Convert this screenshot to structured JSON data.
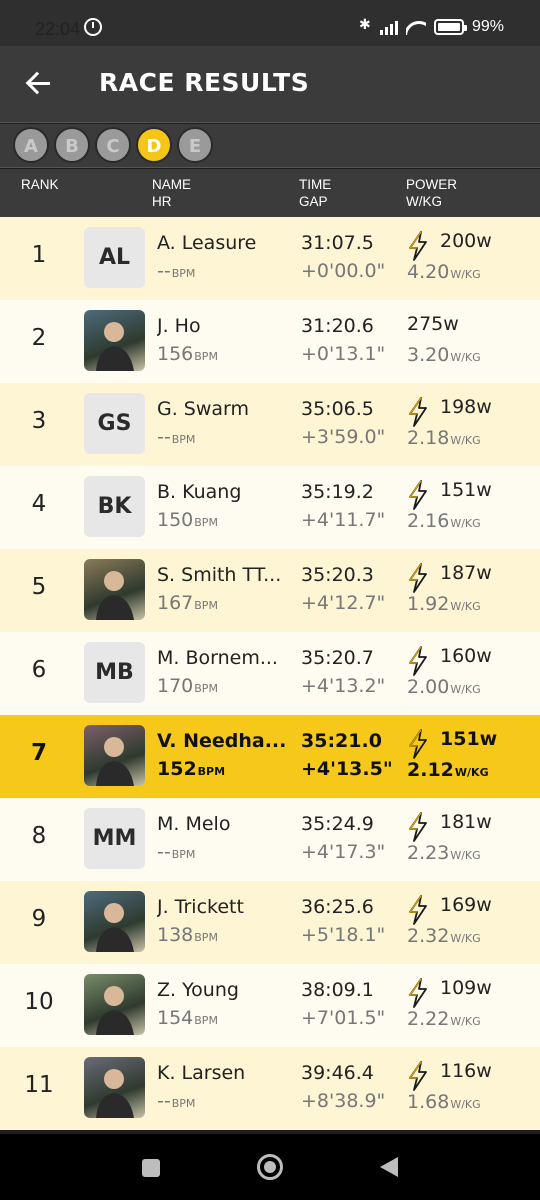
{
  "status": {
    "time": "22:04",
    "battery": "99%"
  },
  "header": {
    "title": "RACE RESULTS"
  },
  "categories": [
    "A",
    "B",
    "C",
    "D",
    "E"
  ],
  "active_category": "D",
  "columns": {
    "rank": "RANK",
    "name": "NAME",
    "hr": "HR",
    "time": "TIME",
    "gap": "GAP",
    "power": "POWER",
    "wkg": "W/KG"
  },
  "units": {
    "bpm": "BPM",
    "wkg": "W/KG"
  },
  "colors": {
    "accent": "#f6c81a",
    "row_odd": "#fdf5d4",
    "row_even": "#fefbf0"
  },
  "results": [
    {
      "rank": "1",
      "initials": "AL",
      "photo": false,
      "name": "A. Leasure",
      "hr": "--",
      "time": "31:07.5",
      "gap": "+0'00.0\"",
      "power": "200w",
      "wkg": "4.20",
      "bolt": true,
      "highlight": false
    },
    {
      "rank": "2",
      "initials": "",
      "photo": true,
      "name": "J. Ho",
      "hr": "156",
      "time": "31:20.6",
      "gap": "+0'13.1\"",
      "power": "275w",
      "wkg": "3.20",
      "bolt": false,
      "highlight": false
    },
    {
      "rank": "3",
      "initials": "GS",
      "photo": false,
      "name": "G. Swarm",
      "hr": "--",
      "time": "35:06.5",
      "gap": "+3'59.0\"",
      "power": "198w",
      "wkg": "2.18",
      "bolt": true,
      "highlight": false
    },
    {
      "rank": "4",
      "initials": "BK",
      "photo": false,
      "name": "B. Kuang",
      "hr": "150",
      "time": "35:19.2",
      "gap": "+4'11.7\"",
      "power": "151w",
      "wkg": "2.16",
      "bolt": true,
      "highlight": false
    },
    {
      "rank": "5",
      "initials": "",
      "photo": true,
      "name": "S. Smith TT...",
      "hr": "167",
      "time": "35:20.3",
      "gap": "+4'12.7\"",
      "power": "187w",
      "wkg": "1.92",
      "bolt": true,
      "highlight": false
    },
    {
      "rank": "6",
      "initials": "MB",
      "photo": false,
      "name": "M. Bornem...",
      "hr": "170",
      "time": "35:20.7",
      "gap": "+4'13.2\"",
      "power": "160w",
      "wkg": "2.00",
      "bolt": true,
      "highlight": false
    },
    {
      "rank": "7",
      "initials": "",
      "photo": true,
      "name": "V. Needha...",
      "hr": "152",
      "time": "35:21.0",
      "gap": "+4'13.5\"",
      "power": "151w",
      "wkg": "2.12",
      "bolt": true,
      "highlight": true
    },
    {
      "rank": "8",
      "initials": "MM",
      "photo": false,
      "name": "M. Melo",
      "hr": "--",
      "time": "35:24.9",
      "gap": "+4'17.3\"",
      "power": "181w",
      "wkg": "2.23",
      "bolt": true,
      "highlight": false
    },
    {
      "rank": "9",
      "initials": "",
      "photo": true,
      "name": "J. Trickett",
      "hr": "138",
      "time": "36:25.6",
      "gap": "+5'18.1\"",
      "power": "169w",
      "wkg": "2.32",
      "bolt": true,
      "highlight": false
    },
    {
      "rank": "10",
      "initials": "",
      "photo": true,
      "name": "Z. Young",
      "hr": "154",
      "time": "38:09.1",
      "gap": "+7'01.5\"",
      "power": "109w",
      "wkg": "2.22",
      "bolt": true,
      "highlight": false
    },
    {
      "rank": "11",
      "initials": "",
      "photo": true,
      "name": "K. Larsen",
      "hr": "--",
      "time": "39:46.4",
      "gap": "+8'38.9\"",
      "power": "116w",
      "wkg": "1.68",
      "bolt": true,
      "highlight": false
    }
  ]
}
